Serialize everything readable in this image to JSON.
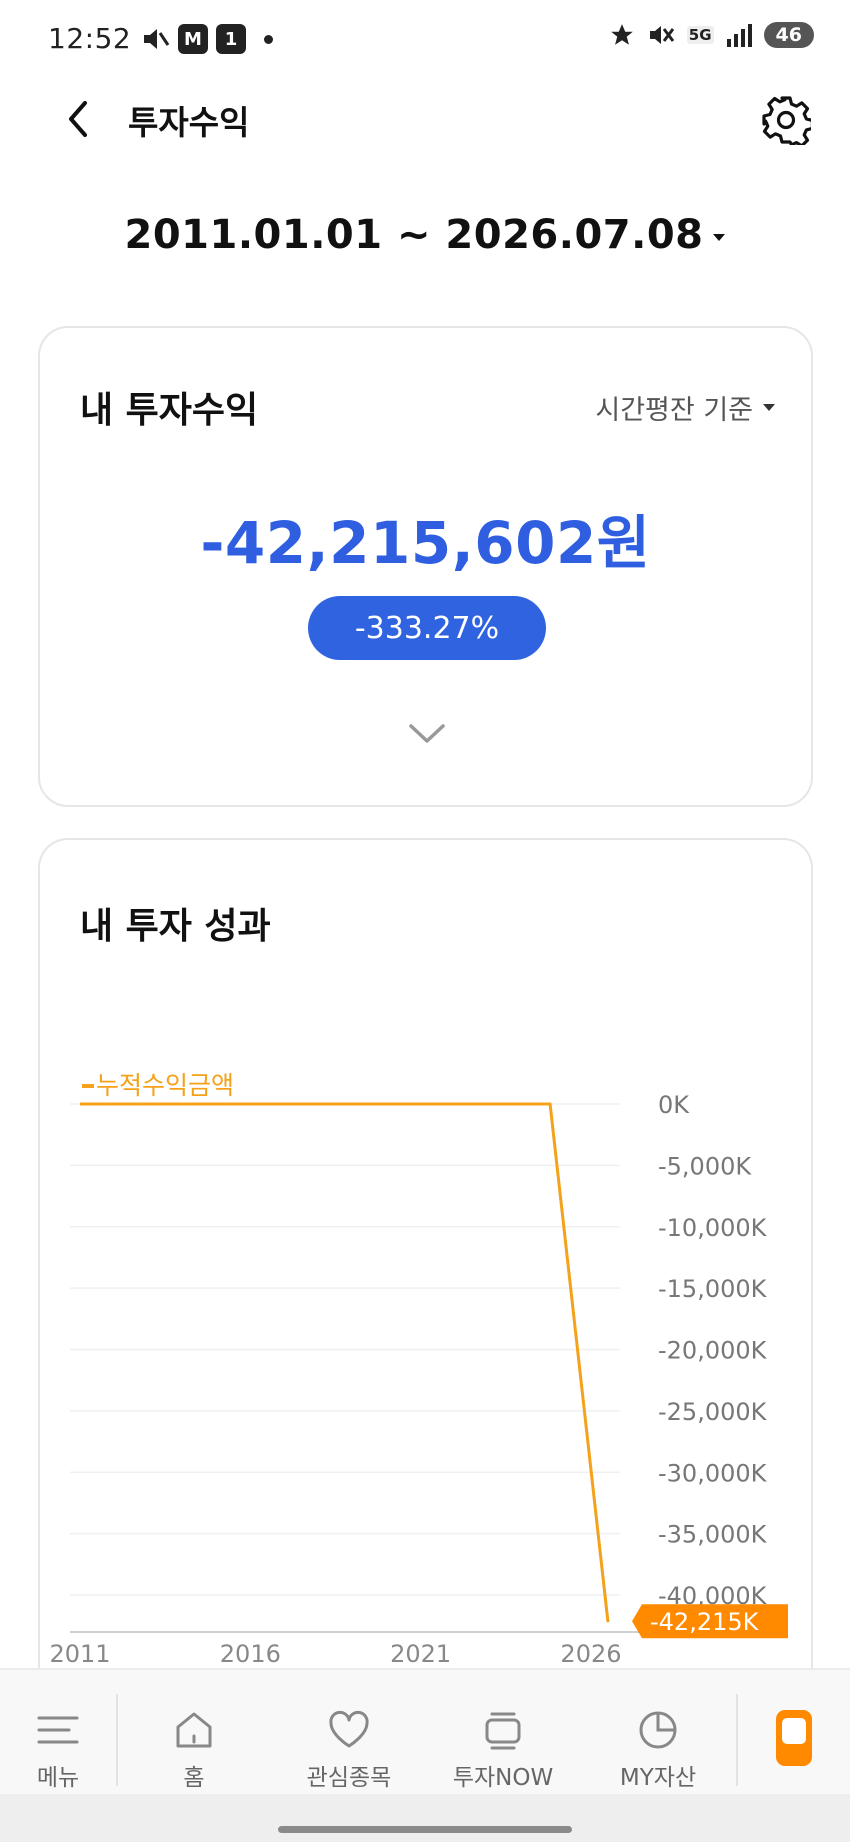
{
  "status_bar": {
    "time": "12:52",
    "left_icons": [
      "mute-icon",
      "m-stock-icon",
      "notification-one-icon",
      "dot-icon"
    ],
    "m_badge": "M",
    "one_badge": "1",
    "network": "5G",
    "battery": "46"
  },
  "header": {
    "title": "투자수익"
  },
  "date_range": "2011.01.01 ~ 2026.07.08",
  "profit_card": {
    "title": "내 투자수익",
    "basis": "시간평잔 기준",
    "amount": "-42,215,602원",
    "rate": "-333.27%"
  },
  "performance_card": {
    "title": "내 투자 성과"
  },
  "colors": {
    "accent_blue": "#2f5fe0",
    "line_orange": "#f5a11a",
    "tag_orange": "#ff8a00"
  },
  "chart_data": {
    "type": "line",
    "series": [
      {
        "name": "누적수익금액",
        "x": [
          "2011",
          "2024.8",
          "2026.5"
        ],
        "values": [
          0,
          0,
          -42215
        ]
      }
    ],
    "x_ticks": [
      "2011",
      "2016",
      "2021",
      "2026"
    ],
    "y_ticks": [
      "0K",
      "-5,000K",
      "-10,000K",
      "-15,000K",
      "-20,000K",
      "-25,000K",
      "-30,000K",
      "-35,000K",
      "-40,000K"
    ],
    "y_tick_values": [
      0,
      -5000,
      -10000,
      -15000,
      -20000,
      -25000,
      -30000,
      -35000,
      -40000
    ],
    "ylim": [
      -42215,
      0
    ],
    "xlim": [
      2011,
      2026.5
    ],
    "grid": true,
    "legend": "top-left",
    "last_value_label": "-42,215K",
    "ylabel": "",
    "xlabel": ""
  },
  "bottom_nav": {
    "items": [
      {
        "label": "메뉴",
        "icon": "menu-icon"
      },
      {
        "label": "홈",
        "icon": "home-icon"
      },
      {
        "label": "관심종목",
        "icon": "heart-icon"
      },
      {
        "label": "투자NOW",
        "icon": "layers-icon"
      },
      {
        "label": "MY자산",
        "icon": "pie-chart-icon"
      }
    ],
    "special_icon": "phone-icon"
  }
}
